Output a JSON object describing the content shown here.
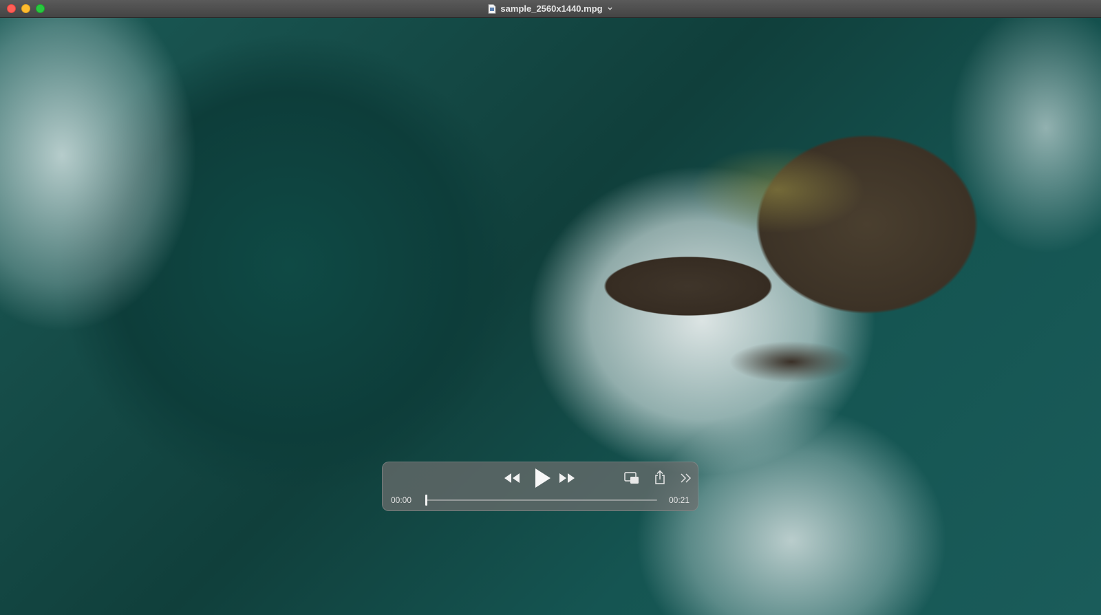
{
  "window": {
    "title": "sample_2560x1440.mpg"
  },
  "player": {
    "current_time": "00:00",
    "duration": "00:21",
    "progress": 0.0,
    "state": "paused"
  },
  "icons": {
    "rewind": "rewind-icon",
    "play": "play-icon",
    "fast_forward": "fast-forward-icon",
    "pip": "picture-in-picture-icon",
    "share": "share-icon",
    "more": "more-chevrons-icon"
  },
  "colors": {
    "close": "#fe5f57",
    "minimize": "#febc2e",
    "maximize": "#28c840",
    "control_bg": "#6e6e6e"
  }
}
